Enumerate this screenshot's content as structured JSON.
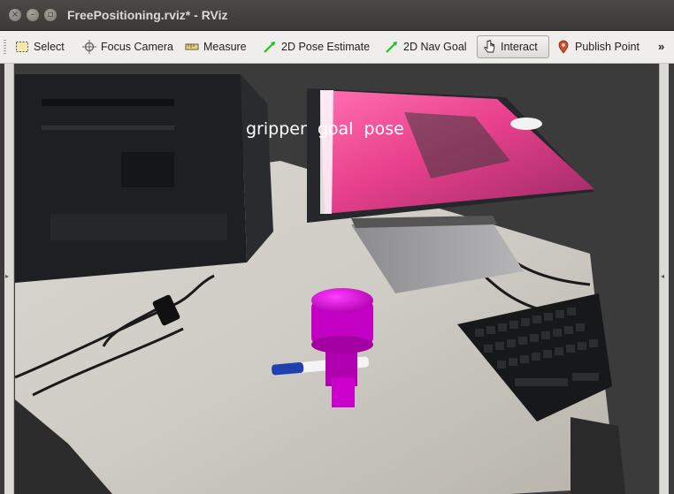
{
  "window": {
    "title": "FreePositioning.rviz* - RViz",
    "close_glyph": "×",
    "minimize_glyph": "–",
    "maximize_glyph": "▫"
  },
  "toolbar": {
    "tools": [
      {
        "id": "select",
        "label": "Select",
        "icon": "select-box-icon",
        "active": false
      },
      {
        "id": "focus-camera",
        "label": "Focus Camera",
        "icon": "crosshair-icon",
        "active": false
      },
      {
        "id": "measure",
        "label": "Measure",
        "icon": "ruler-icon",
        "active": false
      },
      {
        "id": "2d-pose-estimate",
        "label": "2D Pose Estimate",
        "icon": "green-arrow-icon",
        "active": false
      },
      {
        "id": "2d-nav-goal",
        "label": "2D Nav Goal",
        "icon": "green-arrow-icon",
        "active": false
      },
      {
        "id": "interact",
        "label": "Interact",
        "icon": "hand-cursor-icon",
        "active": true
      },
      {
        "id": "publish-point",
        "label": "Publish Point",
        "icon": "map-pin-icon",
        "active": false
      }
    ],
    "overflow_glyph": "»"
  },
  "viewport": {
    "overlay_text": "gripper  goal  pose",
    "split_left_glyph": "▸",
    "split_right_glyph": "◂",
    "colors": {
      "marker": "#cc00cc",
      "background": "#3b3b3b",
      "monitor_glow": "#ff4f9e"
    }
  }
}
